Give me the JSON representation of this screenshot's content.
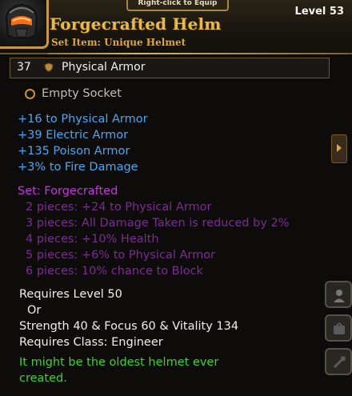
{
  "header": {
    "tab_label": "Right-click to Equip",
    "title": "Forgecrafted Helm",
    "subtitle": "Set Item: Unique Helmet",
    "level": "Level 53",
    "icon": "helmet-icon"
  },
  "armor": {
    "value": "37",
    "label": "Physical Armor",
    "icon": "armor-shield-icon"
  },
  "socket": {
    "label": "Empty Socket"
  },
  "stats": [
    "+16 to Physical Armor",
    "+39 Electric Armor",
    "+135 Poison Armor",
    "+3% to Fire Damage"
  ],
  "set": {
    "title": "Set: Forgecrafted",
    "bonuses": [
      "2 pieces: +24 to Physical Armor",
      "3 pieces: All Damage Taken is reduced by 2%",
      "4 pieces: +10% Health",
      "5 pieces: +6% to Physical Armor",
      "6 pieces: 10% chance to Block"
    ]
  },
  "requirements": {
    "level": "Requires Level 50",
    "or": "Or",
    "attributes": "Strength 40 & Focus 60 & Vitality 134",
    "class": "Requires Class: Engineer"
  },
  "flavor": {
    "line1": "It might be the oldest helmet ever",
    "line2": "created."
  },
  "colors": {
    "title": "#e8b94a",
    "stat_blue": "#4ba6f0",
    "set_purple": "#cc33e6",
    "set_inactive": "#7a2c92",
    "flavor_green": "#3ed22e"
  }
}
